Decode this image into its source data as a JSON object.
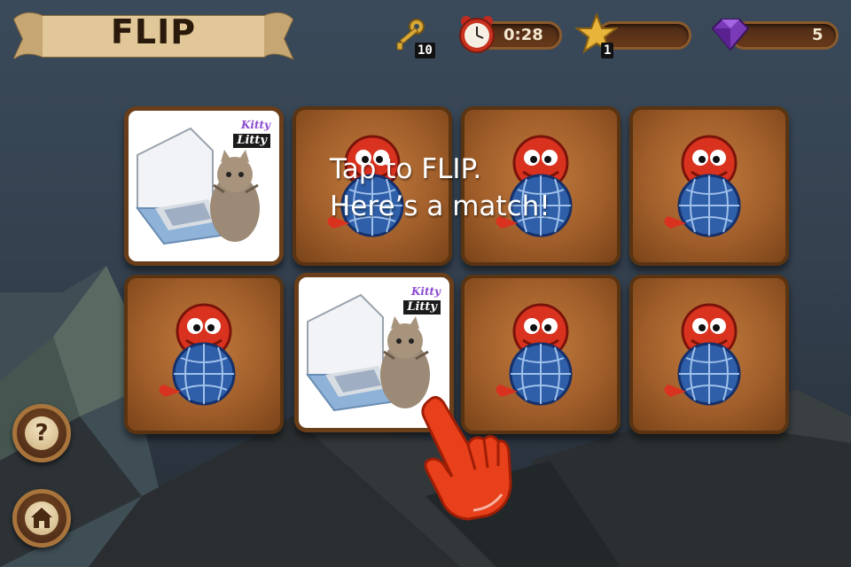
{
  "title": "FLIP",
  "hud": {
    "keys": {
      "icon": "key-icon",
      "count": "10"
    },
    "timer": {
      "icon": "alarm-clock-icon",
      "time": "0:28"
    },
    "stars": {
      "icon": "star-icon",
      "count": "1"
    },
    "gems": {
      "icon": "gem-icon",
      "count": "5"
    }
  },
  "hint": {
    "line1": "Tap to FLIP.",
    "line2": "Here’s a match!"
  },
  "cards": [
    {
      "state": "front",
      "image": "kitten-litter-box",
      "brand_top": "Kitty",
      "brand_bottom": "Litty"
    },
    {
      "state": "back"
    },
    {
      "state": "back"
    },
    {
      "state": "back"
    },
    {
      "state": "back"
    },
    {
      "state": "front",
      "image": "kitten-litter-box",
      "brand_top": "Kitty",
      "brand_bottom": "Litty"
    },
    {
      "state": "back"
    },
    {
      "state": "back"
    }
  ],
  "buttons": {
    "help": {
      "icon": "question-icon",
      "glyph": "?"
    },
    "home": {
      "icon": "home-icon"
    }
  },
  "colors": {
    "wood": "#a25f2b",
    "hint_text": "#ffffff",
    "hand": "#e8401a"
  }
}
